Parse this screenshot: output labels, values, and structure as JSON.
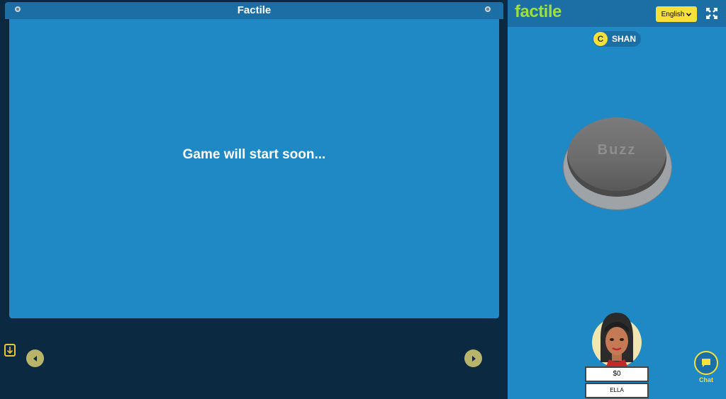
{
  "board": {
    "title": "Factile",
    "message": "Game will start soon..."
  },
  "controls": {
    "download_icon": "download-icon",
    "prev_icon": "arrow-left-icon",
    "next_icon": "arrow-right-icon"
  },
  "panel": {
    "logo": "factile",
    "language": "English",
    "fullscreen_icon": "expand-icon",
    "player": {
      "badge": "C",
      "name": "SHAN"
    },
    "buzz_label": "Buzz",
    "contestant": {
      "score": "$0",
      "name": "ELLA"
    },
    "chat_label": "Chat"
  },
  "colors": {
    "board_blue": "#1e89c4",
    "header_blue": "#1c6fa5",
    "dark_bg": "#0b2a42",
    "logo_green": "#9ee03b",
    "accent_yellow": "#f7e03a"
  }
}
